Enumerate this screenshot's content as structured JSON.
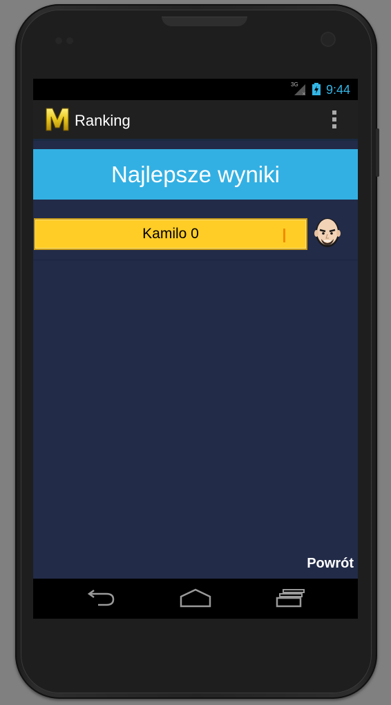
{
  "status_bar": {
    "network_type": "3G",
    "clock": "9:44"
  },
  "action_bar": {
    "title": "Ranking",
    "logo_letter": "M",
    "overflow_icon": "overflow-menu-icon"
  },
  "header": {
    "title": "Najlepsze wyniki"
  },
  "ranking": {
    "entries": [
      {
        "label": "Kamilo 0",
        "avatar_icon": "bald-man-avatar-icon"
      }
    ]
  },
  "footer": {
    "back_label": "Powrót"
  },
  "nav_bar": {
    "icons": [
      "back-icon",
      "home-icon",
      "recent-apps-icon"
    ]
  },
  "colors": {
    "banner": "#33b0e3",
    "content_background": "#222b48",
    "score_bar": "#ffcd26",
    "clock": "#33b5e5"
  }
}
